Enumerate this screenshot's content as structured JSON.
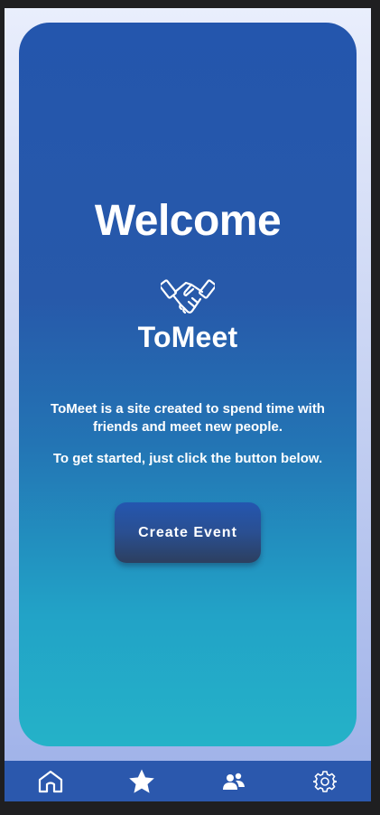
{
  "hero": {
    "title": "Welcome",
    "brand": "ToMeet",
    "description_1": "ToMeet is a site created to spend time with friends and meet new people.",
    "description_2": "To get started, just click the button below.",
    "cta_label": "Create Event",
    "logo_icon": "handshake-icon"
  },
  "navbar": {
    "items": [
      {
        "icon": "home-icon"
      },
      {
        "icon": "star-icon"
      },
      {
        "icon": "users-icon"
      },
      {
        "icon": "gear-icon"
      }
    ]
  },
  "colors": {
    "primary": "#2456ad",
    "gradient_bottom": "#24b2c8",
    "nav_bg": "#2b58ad",
    "text": "#ffffff"
  }
}
